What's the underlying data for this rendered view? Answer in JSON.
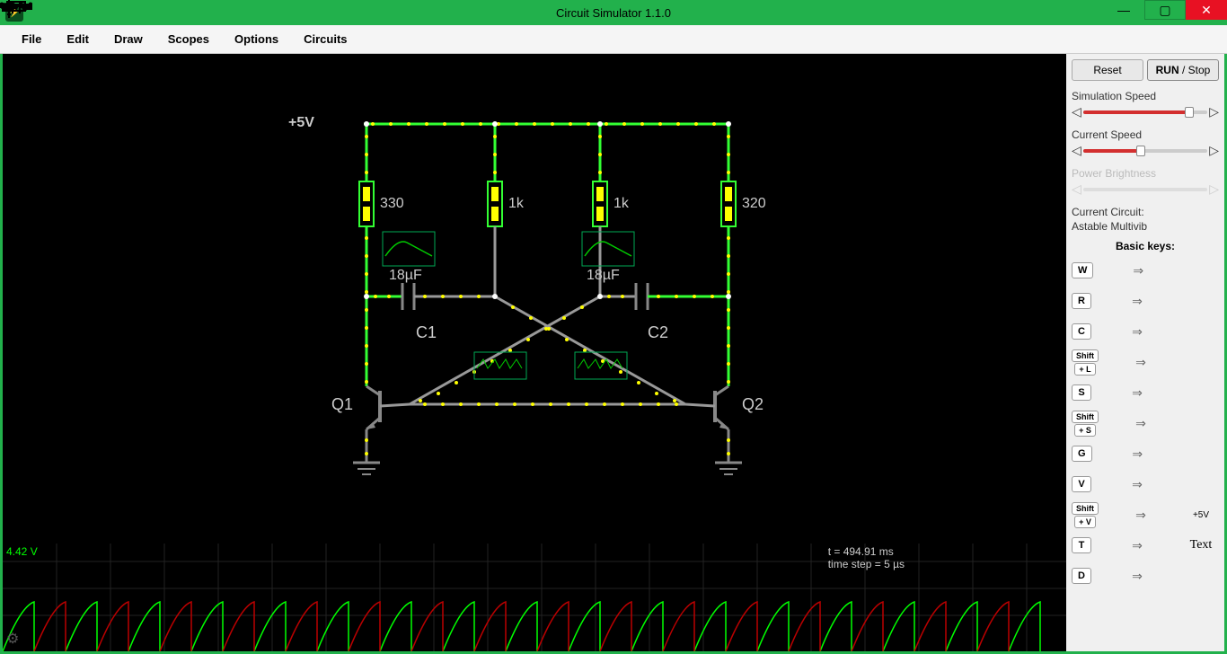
{
  "window": {
    "title": "Circuit Simulator 1.1.0"
  },
  "menu": {
    "file": "File",
    "edit": "Edit",
    "draw": "Draw",
    "scopes": "Scopes",
    "options": "Options",
    "circuits": "Circuits"
  },
  "sidebar": {
    "reset": "Reset",
    "run": "RUN",
    "stop": "Stop",
    "sim_speed_label": "Simulation Speed",
    "current_speed_label": "Current Speed",
    "power_brightness_label": "Power Brightness",
    "current_circuit_label": "Current Circuit:",
    "current_circuit_name": "Astable Multivib",
    "basic_keys_title": "Basic keys:",
    "keys": [
      {
        "label": "W",
        "shift": false,
        "symbol": "wire"
      },
      {
        "label": "R",
        "shift": false,
        "symbol": "resistor"
      },
      {
        "label": "C",
        "shift": false,
        "symbol": "capacitor"
      },
      {
        "label": "L",
        "shift": true,
        "symbol": "inductor"
      },
      {
        "label": "S",
        "shift": false,
        "symbol": "switch-open"
      },
      {
        "label": "S",
        "shift": true,
        "symbol": "switch-closed"
      },
      {
        "label": "G",
        "shift": false,
        "symbol": "ground"
      },
      {
        "label": "V",
        "shift": false,
        "symbol": "voltage"
      },
      {
        "label": "V",
        "shift": true,
        "symbol": "dc-voltage",
        "text": "+5V"
      },
      {
        "label": "T",
        "shift": false,
        "symbol": "text",
        "text": "Text"
      },
      {
        "label": "D",
        "shift": false,
        "symbol": "diode"
      }
    ]
  },
  "circuit": {
    "voltage_label": "+5V",
    "r1_value": "330",
    "r2_value": "1k",
    "r3_value": "1k",
    "r4_value": "320",
    "c1_value": "18µF",
    "c2_value": "18µF",
    "c1_label": "C1",
    "c2_label": "C2",
    "q1_label": "Q1",
    "q2_label": "Q2"
  },
  "scope": {
    "voltage": "4.42 V",
    "time": "t = 494.91 ms",
    "timestep": "time step = 5 µs"
  }
}
